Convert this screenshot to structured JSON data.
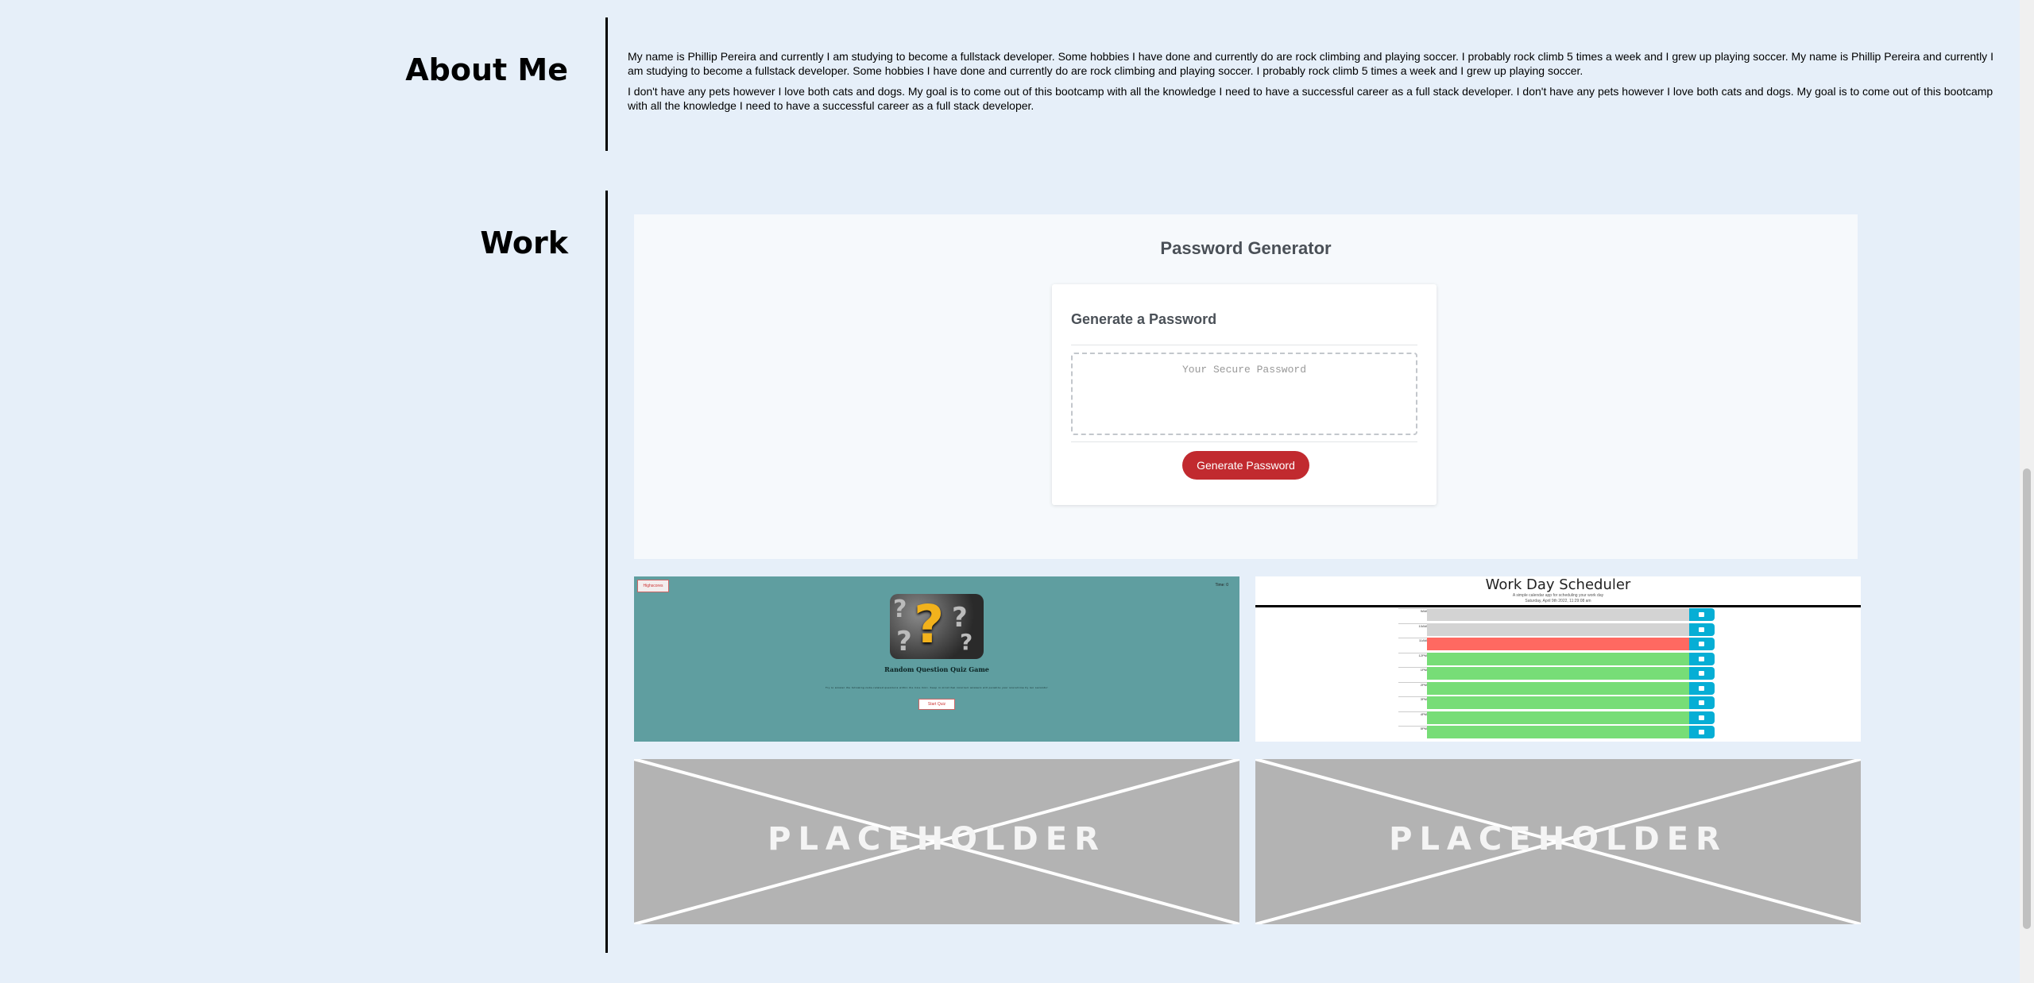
{
  "about": {
    "title": "About Me",
    "paragraphs": [
      "My name is Phillip Pereira and currently I am studying to become a fullstack developer. Some hobbies I have done and currently do are rock climbing and playing soccer. I probably rock climb 5 times a week and I grew up playing soccer. My name is Phillip Pereira and currently I am studying to become a fullstack developer. Some hobbies I have done and currently do are rock climbing and playing soccer. I probably rock climb 5 times a week and I grew up playing soccer.",
      "I don't have any pets however I love both cats and dogs. My goal is to come out of this bootcamp with all the knowledge I need to have a successful career as a full stack developer. I don't have any pets however I love both cats and dogs. My goal is to come out of this bootcamp with all the knowledge I need to have a successful career as a full stack developer."
    ]
  },
  "work": {
    "title": "Work",
    "password_generator": {
      "header": "Password Generator",
      "card_title": "Generate a Password",
      "textarea_placeholder": "Your Secure Password",
      "button_label": "Generate Password",
      "button_color": "#c12a2f"
    },
    "quiz_preview": {
      "highscores_label": "Highscores",
      "timer_label": "Time: 0",
      "title": "Random Question Quiz Game",
      "description": "Try to answer the following code-related questions within the time limit. Keep in mind that incorrect answers will penalize your score/time by ten seconds!",
      "start_label": "Start Quiz",
      "bg_color": "#5f9ea0"
    },
    "scheduler_preview": {
      "title": "Work Day Scheduler",
      "subtitle": "A simple calendar app for scheduling your work day",
      "date": "Saturday, April 9th 2022, 11:29:08 am",
      "hours": [
        "9AM",
        "10AM",
        "11AM",
        "12PM",
        "1PM",
        "2PM",
        "3PM",
        "4PM",
        "5PM"
      ],
      "states": [
        "past",
        "past",
        "present",
        "future",
        "future",
        "future",
        "future",
        "future",
        "future"
      ],
      "colors": {
        "past": "#d3d3d3",
        "present": "#ff6961",
        "future": "#77dd77",
        "save": "#06aed5"
      }
    },
    "placeholder_label": "PLACEHOLDER"
  }
}
